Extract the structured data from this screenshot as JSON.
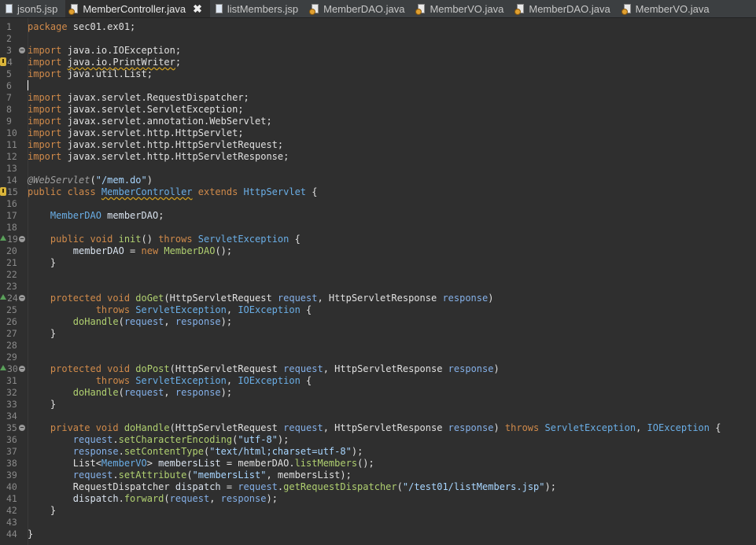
{
  "tabs": [
    {
      "label": "json5.jsp",
      "type": "jsp",
      "active": false
    },
    {
      "label": "MemberController.java",
      "type": "java",
      "active": true,
      "closable": true
    },
    {
      "label": "listMembers.jsp",
      "type": "jsp",
      "active": false
    },
    {
      "label": "MemberDAO.java",
      "type": "java",
      "active": false
    },
    {
      "label": "MemberVO.java",
      "type": "java",
      "active": false
    },
    {
      "label": "MemberDAO.java",
      "type": "java",
      "active": false
    },
    {
      "label": "MemberVO.java",
      "type": "java",
      "active": false
    }
  ],
  "close_glyph": "✖",
  "lines": [
    {
      "n": "1",
      "t": [
        [
          "kw",
          "package"
        ],
        [
          "pl",
          " sec01.ex01;"
        ]
      ]
    },
    {
      "n": "2",
      "t": []
    },
    {
      "n": "3",
      "fold": true,
      "t": [
        [
          "kw",
          "import"
        ],
        [
          "pl",
          " java.io.IOException;"
        ]
      ]
    },
    {
      "n": "4",
      "warn": true,
      "t": [
        [
          "kw",
          "import"
        ],
        [
          "pl",
          " "
        ],
        [
          "pl sq",
          "java.io.PrintWriter"
        ],
        [
          "pl",
          ";"
        ]
      ]
    },
    {
      "n": "5",
      "t": [
        [
          "kw",
          "import"
        ],
        [
          "pl",
          " java.util.List;"
        ]
      ]
    },
    {
      "n": "6",
      "cursor": true,
      "t": []
    },
    {
      "n": "7",
      "t": [
        [
          "kw",
          "import"
        ],
        [
          "pl",
          " javax.servlet.RequestDispatcher;"
        ]
      ]
    },
    {
      "n": "8",
      "t": [
        [
          "kw",
          "import"
        ],
        [
          "pl",
          " javax.servlet.ServletException;"
        ]
      ]
    },
    {
      "n": "9",
      "t": [
        [
          "kw",
          "import"
        ],
        [
          "pl",
          " javax.servlet.annotation.WebServlet;"
        ]
      ]
    },
    {
      "n": "10",
      "t": [
        [
          "kw",
          "import"
        ],
        [
          "pl",
          " javax.servlet.http.HttpServlet;"
        ]
      ]
    },
    {
      "n": "11",
      "t": [
        [
          "kw",
          "import"
        ],
        [
          "pl",
          " javax.servlet.http.HttpServletRequest;"
        ]
      ]
    },
    {
      "n": "12",
      "t": [
        [
          "kw",
          "import"
        ],
        [
          "pl",
          " javax.servlet.http.HttpServletResponse;"
        ]
      ]
    },
    {
      "n": "13",
      "t": []
    },
    {
      "n": "14",
      "t": [
        [
          "an",
          "@WebServlet"
        ],
        [
          "pl",
          "("
        ],
        [
          "st",
          "\"/mem.do\""
        ],
        [
          "pl",
          ")"
        ]
      ]
    },
    {
      "n": "15",
      "warn": true,
      "t": [
        [
          "kw",
          "public class "
        ],
        [
          "ty sq",
          "MemberController"
        ],
        [
          "pl",
          " "
        ],
        [
          "kw",
          "extends "
        ],
        [
          "ty",
          "HttpServlet"
        ],
        [
          "pl",
          " {"
        ]
      ]
    },
    {
      "n": "16",
      "t": []
    },
    {
      "n": "17",
      "t": [
        [
          "pl",
          "    "
        ],
        [
          "ty",
          "MemberDAO"
        ],
        [
          "va",
          " memberDAO"
        ],
        [
          "pl",
          ";"
        ]
      ]
    },
    {
      "n": "18",
      "t": []
    },
    {
      "n": "19",
      "fold": true,
      "ov": true,
      "t": [
        [
          "pl",
          "    "
        ],
        [
          "kw",
          "public void "
        ],
        [
          "fn",
          "init"
        ],
        [
          "pl",
          "() "
        ],
        [
          "kw",
          "throws "
        ],
        [
          "ty",
          "ServletException"
        ],
        [
          "pl",
          " {"
        ]
      ]
    },
    {
      "n": "20",
      "t": [
        [
          "pl",
          "        "
        ],
        [
          "va",
          "memberDAO"
        ],
        [
          "pl",
          " = "
        ],
        [
          "kw",
          "new "
        ],
        [
          "fn",
          "MemberDAO"
        ],
        [
          "pl",
          "();"
        ]
      ]
    },
    {
      "n": "21",
      "t": [
        [
          "pl",
          "    }"
        ]
      ]
    },
    {
      "n": "22",
      "t": []
    },
    {
      "n": "23",
      "t": []
    },
    {
      "n": "24",
      "fold": true,
      "ov": true,
      "t": [
        [
          "pl",
          "    "
        ],
        [
          "kw",
          "protected void "
        ],
        [
          "fn",
          "doGet"
        ],
        [
          "pl",
          "(HttpServletRequest "
        ],
        [
          "pa",
          "request"
        ],
        [
          "pl",
          ", HttpServletResponse "
        ],
        [
          "pa",
          "response"
        ],
        [
          "pl",
          ")"
        ]
      ]
    },
    {
      "n": "25",
      "t": [
        [
          "pl",
          "            "
        ],
        [
          "kw",
          "throws "
        ],
        [
          "ty",
          "ServletException"
        ],
        [
          "pl",
          ", "
        ],
        [
          "ty",
          "IOException"
        ],
        [
          "pl",
          " {"
        ]
      ]
    },
    {
      "n": "26",
      "t": [
        [
          "pl",
          "        "
        ],
        [
          "fn",
          "doHandle"
        ],
        [
          "pl",
          "("
        ],
        [
          "pa",
          "request"
        ],
        [
          "pl",
          ", "
        ],
        [
          "pa",
          "response"
        ],
        [
          "pl",
          ");"
        ]
      ]
    },
    {
      "n": "27",
      "t": [
        [
          "pl",
          "    }"
        ]
      ]
    },
    {
      "n": "28",
      "t": []
    },
    {
      "n": "29",
      "t": []
    },
    {
      "n": "30",
      "fold": true,
      "ov": true,
      "t": [
        [
          "pl",
          "    "
        ],
        [
          "kw",
          "protected void "
        ],
        [
          "fn",
          "doPost"
        ],
        [
          "pl",
          "(HttpServletRequest "
        ],
        [
          "pa",
          "request"
        ],
        [
          "pl",
          ", HttpServletResponse "
        ],
        [
          "pa",
          "response"
        ],
        [
          "pl",
          ")"
        ]
      ]
    },
    {
      "n": "31",
      "t": [
        [
          "pl",
          "            "
        ],
        [
          "kw",
          "throws "
        ],
        [
          "ty",
          "ServletException"
        ],
        [
          "pl",
          ", "
        ],
        [
          "ty",
          "IOException"
        ],
        [
          "pl",
          " {"
        ]
      ]
    },
    {
      "n": "32",
      "t": [
        [
          "pl",
          "        "
        ],
        [
          "fn",
          "doHandle"
        ],
        [
          "pl",
          "("
        ],
        [
          "pa",
          "request"
        ],
        [
          "pl",
          ", "
        ],
        [
          "pa",
          "response"
        ],
        [
          "pl",
          ");"
        ]
      ]
    },
    {
      "n": "33",
      "t": [
        [
          "pl",
          "    }"
        ]
      ]
    },
    {
      "n": "34",
      "t": []
    },
    {
      "n": "35",
      "fold": true,
      "t": [
        [
          "pl",
          "    "
        ],
        [
          "kw",
          "private void "
        ],
        [
          "fn",
          "doHandle"
        ],
        [
          "pl",
          "(HttpServletRequest "
        ],
        [
          "pa",
          "request"
        ],
        [
          "pl",
          ", HttpServletResponse "
        ],
        [
          "pa",
          "response"
        ],
        [
          "pl",
          ") "
        ],
        [
          "kw",
          "throws "
        ],
        [
          "ty",
          "ServletException"
        ],
        [
          "pl",
          ", "
        ],
        [
          "ty",
          "IOException"
        ],
        [
          "pl",
          " {"
        ]
      ]
    },
    {
      "n": "36",
      "t": [
        [
          "pl",
          "        "
        ],
        [
          "pa",
          "request"
        ],
        [
          "pl",
          "."
        ],
        [
          "fn",
          "setCharacterEncoding"
        ],
        [
          "pl",
          "("
        ],
        [
          "st",
          "\"utf-8\""
        ],
        [
          "pl",
          ");"
        ]
      ]
    },
    {
      "n": "37",
      "t": [
        [
          "pl",
          "        "
        ],
        [
          "pa",
          "response"
        ],
        [
          "pl",
          "."
        ],
        [
          "fn",
          "setContentType"
        ],
        [
          "pl",
          "("
        ],
        [
          "st",
          "\"text/html;charset=utf-8\""
        ],
        [
          "pl",
          ");"
        ]
      ]
    },
    {
      "n": "38",
      "t": [
        [
          "pl",
          "        List<"
        ],
        [
          "ty",
          "MemberVO"
        ],
        [
          "pl",
          "> "
        ],
        [
          "va",
          "membersList"
        ],
        [
          "pl",
          " = memberDAO."
        ],
        [
          "fn",
          "listMembers"
        ],
        [
          "pl",
          "();"
        ]
      ]
    },
    {
      "n": "39",
      "t": [
        [
          "pl",
          "        "
        ],
        [
          "pa",
          "request"
        ],
        [
          "pl",
          "."
        ],
        [
          "fn",
          "setAttribute"
        ],
        [
          "pl",
          "("
        ],
        [
          "st",
          "\"membersList\""
        ],
        [
          "pl",
          ", membersList);"
        ]
      ]
    },
    {
      "n": "40",
      "t": [
        [
          "pl",
          "        RequestDispatcher "
        ],
        [
          "va",
          "dispatch"
        ],
        [
          "pl",
          " = "
        ],
        [
          "pa",
          "request"
        ],
        [
          "pl",
          "."
        ],
        [
          "fn",
          "getRequestDispatcher"
        ],
        [
          "pl",
          "("
        ],
        [
          "st",
          "\"/test01/listMembers.jsp\""
        ],
        [
          "pl",
          ");"
        ]
      ]
    },
    {
      "n": "41",
      "t": [
        [
          "pl",
          "        "
        ],
        [
          "va",
          "dispatch"
        ],
        [
          "pl",
          "."
        ],
        [
          "fn",
          "forward"
        ],
        [
          "pl",
          "("
        ],
        [
          "pa",
          "request"
        ],
        [
          "pl",
          ", "
        ],
        [
          "pa",
          "response"
        ],
        [
          "pl",
          ");"
        ]
      ]
    },
    {
      "n": "42",
      "t": [
        [
          "pl",
          "    }"
        ]
      ]
    },
    {
      "n": "43",
      "t": []
    },
    {
      "n": "44",
      "t": [
        [
          "pl",
          "}"
        ]
      ]
    }
  ]
}
